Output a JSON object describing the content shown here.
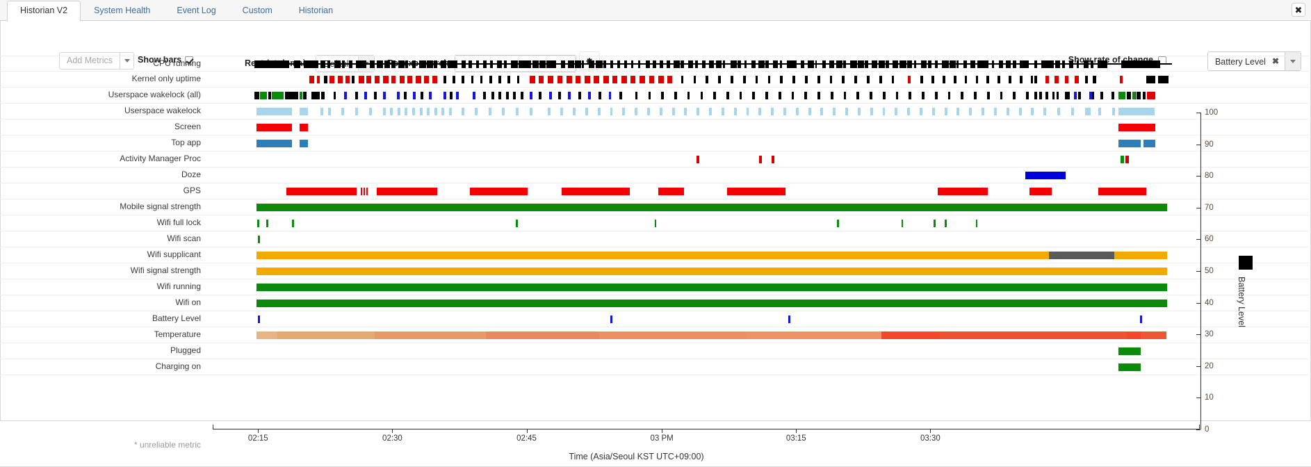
{
  "window": {
    "close_label": "✖"
  },
  "tabs": [
    {
      "label": "Historian V2",
      "active": true
    },
    {
      "label": "System Health",
      "active": false
    },
    {
      "label": "Event Log",
      "active": false
    },
    {
      "label": "Custom",
      "active": false
    },
    {
      "label": "Historian",
      "active": false
    }
  ],
  "toolbar": {
    "add_metrics_label": "Add Metrics",
    "show_bars_label": "Show bars",
    "show_bars_checked": true,
    "restrict_domain_label": "Restrict domain",
    "restrict_domain_value": "Default",
    "regexp_label": "Regexp search",
    "regexp_value": "",
    "regexp_placeholder": "",
    "settings_icon": "gear-icon",
    "show_rate_of_change_label": "Show rate of change",
    "show_rate_of_change_checked": false,
    "metric_value": "Battery Level",
    "metric_remove": "✖"
  },
  "chart_data": {
    "type": "timeline",
    "title": "",
    "xlabel": "Time (Asia/Seoul KST UTC+09:00)",
    "ylabel": "Battery Level",
    "legend": [
      {
        "name": "Battery Level",
        "color": "#000000"
      }
    ],
    "ylim": [
      0,
      100
    ],
    "yticks": [
      0,
      10,
      20,
      30,
      40,
      50,
      60,
      70,
      80,
      90,
      100
    ],
    "xticks": [
      "02:15",
      "02:30",
      "02:45",
      "03 PM",
      "03:15",
      "03:30"
    ],
    "xtick_positions_pct": [
      4.6,
      18.2,
      31.8,
      45.5,
      59.1,
      72.7
    ],
    "footnote": "* unreliable metric",
    "rows": [
      {
        "label": "CPU running",
        "color": "#000000"
      },
      {
        "label": "Kernel only uptime",
        "color": "#d40000"
      },
      {
        "label": "Userspace wakelock (all)",
        "color": "#000000"
      },
      {
        "label": "Userspace wakelock",
        "color": "#a8d4ec"
      },
      {
        "label": "Screen",
        "color": "#f40000"
      },
      {
        "label": "Top app",
        "color": "#2c7fb8"
      },
      {
        "label": "Activity Manager Proc",
        "color": "#d40000"
      },
      {
        "label": "Doze",
        "color": "#0000dd"
      },
      {
        "label": "GPS",
        "color": "#f40000"
      },
      {
        "label": "Mobile signal strength",
        "color": "#0b8a0b"
      },
      {
        "label": "Wifi full lock",
        "color": "#0b8a0b"
      },
      {
        "label": "Wifi scan",
        "color": "#0b8a0b"
      },
      {
        "label": "Wifi supplicant",
        "color": "#f2a900"
      },
      {
        "label": "Wifi signal strength",
        "color": "#f2a900"
      },
      {
        "label": "Wifi running",
        "color": "#0b8a0b"
      },
      {
        "label": "Wifi on",
        "color": "#0b8a0b"
      },
      {
        "label": "Battery Level",
        "color": "#0000dd"
      },
      {
        "label": "Temperature",
        "color": "#e8a870"
      },
      {
        "label": "Plugged",
        "color": "#0b8a0b"
      },
      {
        "label": "Charging on",
        "color": "#0b8a0b"
      }
    ]
  }
}
